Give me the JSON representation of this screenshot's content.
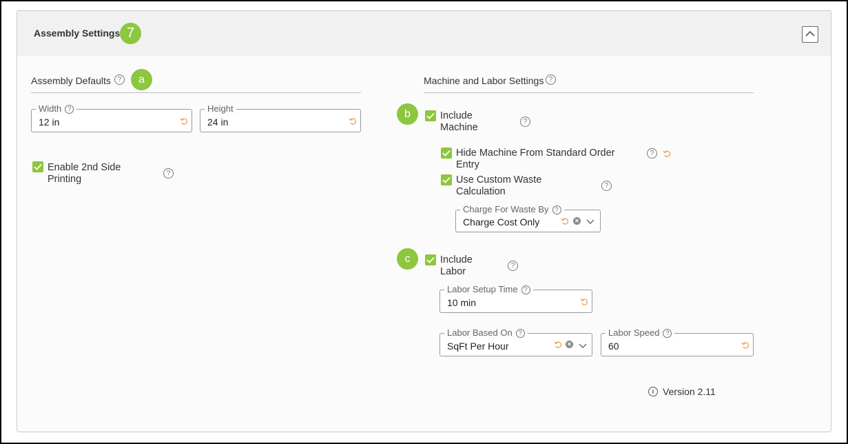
{
  "panel": {
    "title": "Assembly Settings",
    "badge": "7",
    "collapse_icon": "chevron-up-icon"
  },
  "assembly_defaults": {
    "title": "Assembly Defaults",
    "badge": "a",
    "width": {
      "label": "Width",
      "value": "12 in"
    },
    "height": {
      "label": "Height",
      "value": "24 in"
    },
    "second_side": {
      "label_line1": "Enable 2nd Side",
      "label_line2": "Printing",
      "checked": true
    }
  },
  "machine_labor": {
    "title": "Machine and Labor Settings",
    "machine_badge": "b",
    "include_machine": {
      "label_line1": "Include",
      "label_line2": "Machine",
      "checked": true
    },
    "hide_machine": {
      "label_line1": "Hide Machine From Standard Order",
      "label_line2": "Entry",
      "checked": true
    },
    "custom_waste": {
      "label_line1": "Use Custom Waste",
      "label_line2": "Calculation",
      "checked": true
    },
    "charge_for_waste": {
      "label": "Charge For Waste By",
      "value": "Charge Cost Only"
    },
    "labor_badge": "c",
    "include_labor": {
      "label_line1": "Include",
      "label_line2": "Labor",
      "checked": true
    },
    "labor_setup_time": {
      "label": "Labor Setup Time",
      "value": "10 min"
    },
    "labor_based_on": {
      "label": "Labor Based On",
      "value": "SqFt Per Hour"
    },
    "labor_speed": {
      "label": "Labor Speed",
      "value": "60"
    }
  },
  "footer": {
    "version": "Version 2.11"
  },
  "colors": {
    "accent": "#8dc63f",
    "reset": "#f0a050",
    "header_bg": "#f1f1f1"
  }
}
